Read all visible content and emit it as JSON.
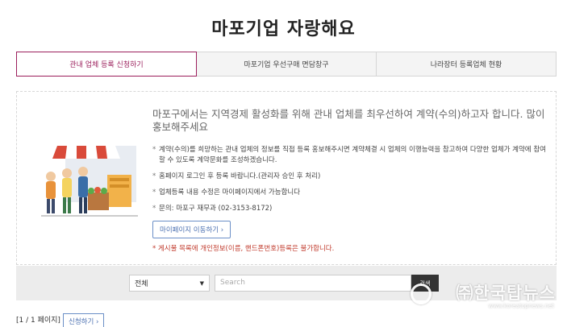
{
  "page": {
    "title": "마포기업 자랑해요"
  },
  "tabs": [
    {
      "label": "관내 업체 등록 신청하기",
      "active": true
    },
    {
      "label": "마포기업 우선구매 면담창구",
      "active": false
    },
    {
      "label": "나라장터 등록업체 현황",
      "active": false
    }
  ],
  "info": {
    "headline": "마포구에서는 지역경제 활성화를 위해 관내 업체를 최우선하여 계약(수의)하고자 합니다. 많이 홍보해주세요",
    "bullets": [
      "계약(수의)를 희망하는 관내 업체의 정보를 직접 등록 홍보해주시면 계약체결 시 업체의 이행능력을 참고하여 다양한 업체가 계약에 참여 할 수 있도록 계약문화를 조성하겠습니다.",
      "홈페이지 로그인 후 등록 바랍니다.(관리자 승인 후 처리)",
      "업체등록 내용 수정은 마이페이지에서 가능합니다",
      "문의: 마포구 재무과 (02-3153-8172)"
    ],
    "mypage_button": "마이페이지 이동하기 ›",
    "warning": "* 게시물 목록에 개인정보(이름, 핸드폰번호)등록은 불가합니다."
  },
  "search": {
    "select_value": "전체",
    "placeholder": "Search",
    "button_label": "검색"
  },
  "pager": {
    "info": "[1 / 1 페이지]",
    "apply_button": "신청하기 ›"
  },
  "watermark": {
    "main": "㈜한국탑뉴스",
    "sub": "www.koreatopnews.net"
  },
  "colors": {
    "accent": "#9b1f5c",
    "link_blue": "#4a6fb0",
    "warning_red": "#c0392b"
  }
}
